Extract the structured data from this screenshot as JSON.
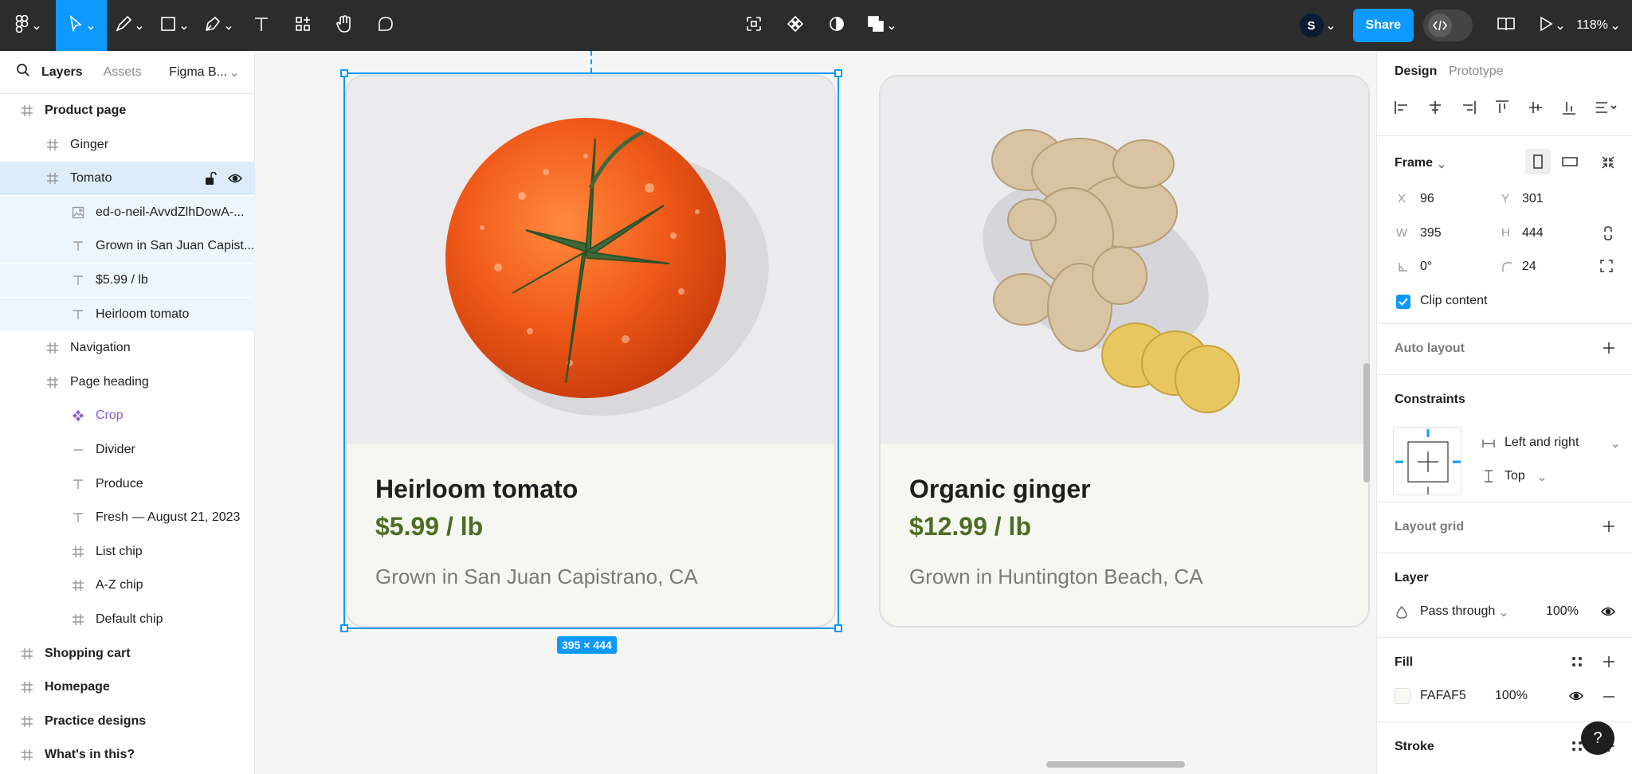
{
  "toolbar": {
    "share_label": "Share",
    "zoom": "118%",
    "avatar_initial": "S"
  },
  "left_panel": {
    "tabs": {
      "layers": "Layers",
      "assets": "Assets",
      "page": "Figma B..."
    },
    "layers": [
      {
        "label": "Product page",
        "icon": "hash-icon"
      },
      {
        "label": "Ginger",
        "icon": "hash-icon"
      },
      {
        "label": "Tomato",
        "icon": "hash-icon"
      },
      {
        "label": "ed-o-neil-AvvdZlhDowA-...",
        "icon": "image-icon"
      },
      {
        "label": "Grown in San Juan Capist...",
        "icon": "text-icon"
      },
      {
        "label": "$5.99 / lb",
        "icon": "text-icon"
      },
      {
        "label": "Heirloom tomato",
        "icon": "text-icon"
      },
      {
        "label": "Navigation",
        "icon": "hash-icon"
      },
      {
        "label": "Page heading",
        "icon": "hash-icon"
      },
      {
        "label": "Crop",
        "icon": "component-icon"
      },
      {
        "label": "Divider",
        "icon": "line-icon"
      },
      {
        "label": "Produce",
        "icon": "text-icon"
      },
      {
        "label": "Fresh — August 21, 2023",
        "icon": "text-icon"
      },
      {
        "label": "List chip",
        "icon": "hash-icon"
      },
      {
        "label": "A-Z chip",
        "icon": "hash-icon"
      },
      {
        "label": "Default chip",
        "icon": "hash-icon"
      },
      {
        "label": "Shopping cart",
        "icon": "hash-icon"
      },
      {
        "label": "Homepage",
        "icon": "hash-icon"
      },
      {
        "label": "Practice designs",
        "icon": "hash-icon"
      },
      {
        "label": "What's in this?",
        "icon": "hash-icon"
      }
    ]
  },
  "canvas": {
    "cards": [
      {
        "title": "Heirloom tomato",
        "price": "$5.99 / lb",
        "origin": "Grown in San Juan Capistrano, CA"
      },
      {
        "title": "Organic ginger",
        "price": "$12.99 / lb",
        "origin": "Grown in Huntington Beach, CA"
      }
    ],
    "dimension_badge": "395 × 444"
  },
  "right_panel": {
    "tabs": {
      "design": "Design",
      "prototype": "Prototype"
    },
    "frame": {
      "title": "Frame",
      "x_label": "X",
      "x": "96",
      "y_label": "Y",
      "y": "301",
      "w_label": "W",
      "w": "395",
      "h_label": "H",
      "h": "444",
      "rotation": "0°",
      "radius": "24",
      "clip_content": "Clip content"
    },
    "auto_layout": "Auto layout",
    "constraints": {
      "title": "Constraints",
      "horizontal": "Left and right",
      "vertical": "Top"
    },
    "layout_grid": "Layout grid",
    "layer": {
      "title": "Layer",
      "blend": "Pass through",
      "opacity": "100%"
    },
    "fill": {
      "title": "Fill",
      "hex": "FAFAF5",
      "opacity": "100%"
    },
    "stroke": {
      "title": "Stroke"
    },
    "help": "?"
  },
  "colors": {
    "accent": "#0d99ff",
    "price": "#4d6d24",
    "fill": "#FAFAF5"
  }
}
